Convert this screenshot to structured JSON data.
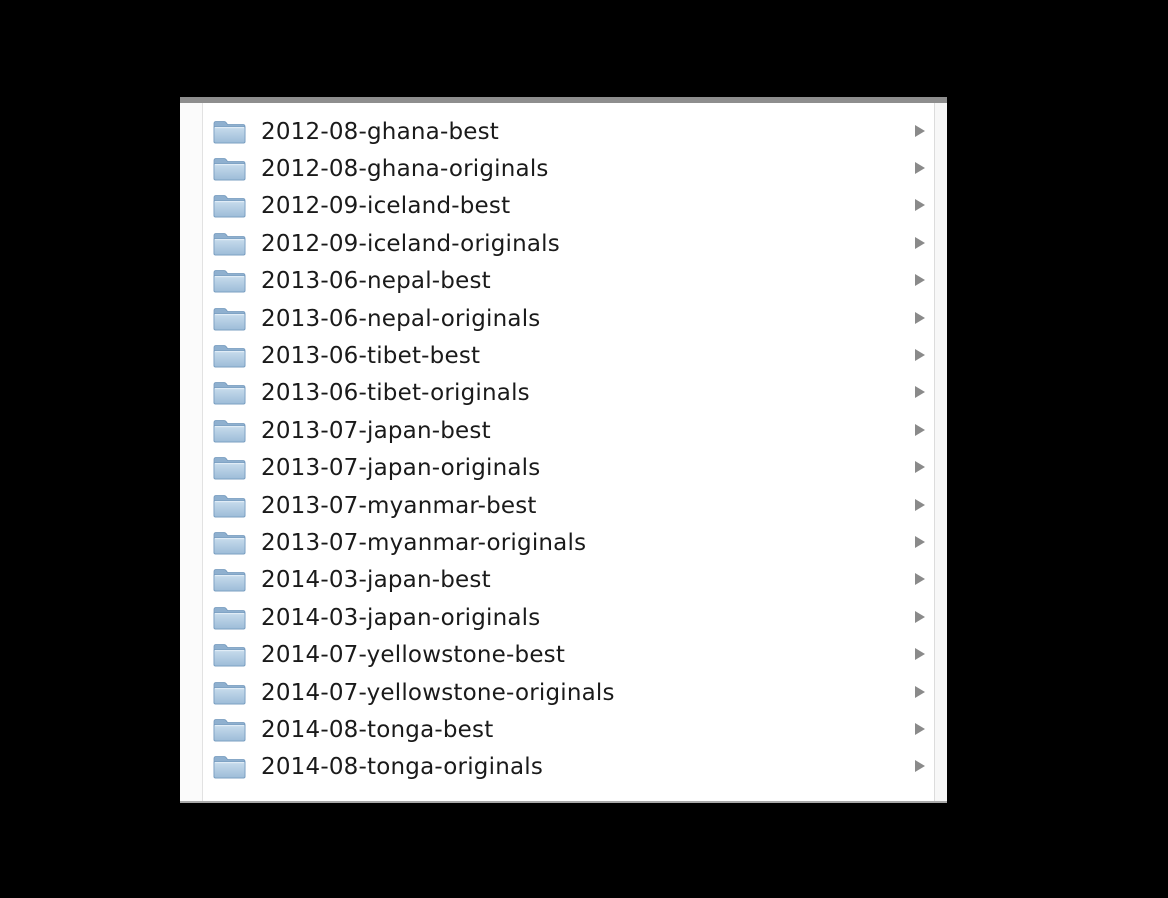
{
  "colors": {
    "background": "#000000",
    "panel": "#ffffff",
    "folder_icon": "#a9c6e0",
    "disclosure_arrow": "#8a8a8a"
  },
  "folders": [
    {
      "name": "2012-08-ghana-best",
      "icon": "folder-icon",
      "arrow": "disclosure-arrow-icon"
    },
    {
      "name": "2012-08-ghana-originals",
      "icon": "folder-icon",
      "arrow": "disclosure-arrow-icon"
    },
    {
      "name": "2012-09-iceland-best",
      "icon": "folder-icon",
      "arrow": "disclosure-arrow-icon"
    },
    {
      "name": "2012-09-iceland-originals",
      "icon": "folder-icon",
      "arrow": "disclosure-arrow-icon"
    },
    {
      "name": "2013-06-nepal-best",
      "icon": "folder-icon",
      "arrow": "disclosure-arrow-icon"
    },
    {
      "name": "2013-06-nepal-originals",
      "icon": "folder-icon",
      "arrow": "disclosure-arrow-icon"
    },
    {
      "name": "2013-06-tibet-best",
      "icon": "folder-icon",
      "arrow": "disclosure-arrow-icon"
    },
    {
      "name": "2013-06-tibet-originals",
      "icon": "folder-icon",
      "arrow": "disclosure-arrow-icon"
    },
    {
      "name": "2013-07-japan-best",
      "icon": "folder-icon",
      "arrow": "disclosure-arrow-icon"
    },
    {
      "name": "2013-07-japan-originals",
      "icon": "folder-icon",
      "arrow": "disclosure-arrow-icon"
    },
    {
      "name": "2013-07-myanmar-best",
      "icon": "folder-icon",
      "arrow": "disclosure-arrow-icon"
    },
    {
      "name": "2013-07-myanmar-originals",
      "icon": "folder-icon",
      "arrow": "disclosure-arrow-icon"
    },
    {
      "name": "2014-03-japan-best",
      "icon": "folder-icon",
      "arrow": "disclosure-arrow-icon"
    },
    {
      "name": "2014-03-japan-originals",
      "icon": "folder-icon",
      "arrow": "disclosure-arrow-icon"
    },
    {
      "name": "2014-07-yellowstone-best",
      "icon": "folder-icon",
      "arrow": "disclosure-arrow-icon"
    },
    {
      "name": "2014-07-yellowstone-originals",
      "icon": "folder-icon",
      "arrow": "disclosure-arrow-icon"
    },
    {
      "name": "2014-08-tonga-best",
      "icon": "folder-icon",
      "arrow": "disclosure-arrow-icon"
    },
    {
      "name": "2014-08-tonga-originals",
      "icon": "folder-icon",
      "arrow": "disclosure-arrow-icon"
    }
  ]
}
